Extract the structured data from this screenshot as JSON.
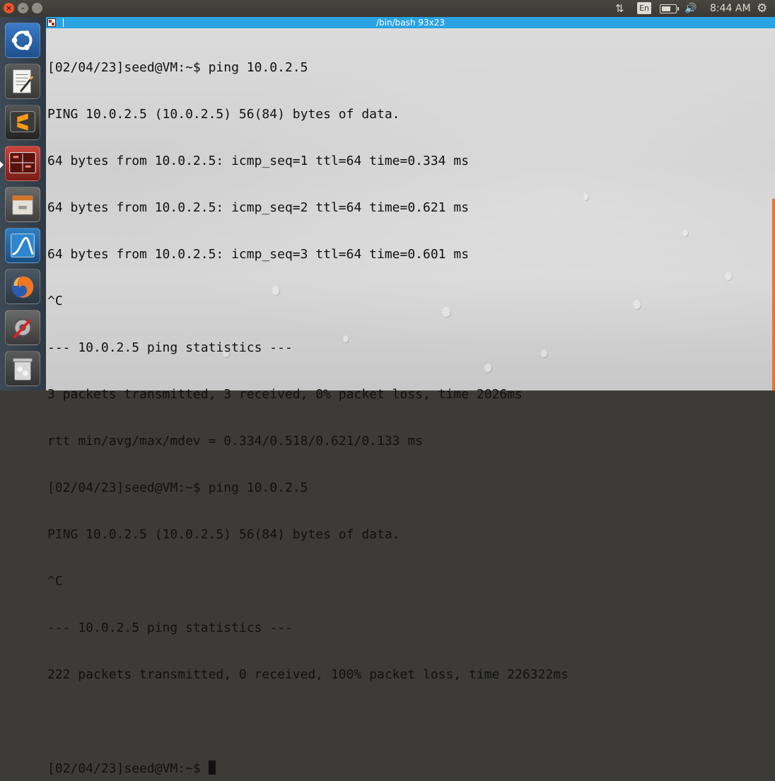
{
  "top_panel": {
    "language": "En",
    "clock": "8:44 AM",
    "volume_glyph": "🔊",
    "network_glyph": "⇅",
    "settings_glyph": "⚙"
  },
  "window_controls": {
    "close": "×",
    "minimize": "–",
    "maximize": ""
  },
  "launcher": {
    "items": [
      {
        "name": "ubuntu-dash",
        "icon": "ubuntu-logo-icon"
      },
      {
        "name": "text-editor",
        "icon": "text-editor-icon"
      },
      {
        "name": "sublime-text",
        "icon": "sublime-text-icon"
      },
      {
        "name": "terminal",
        "icon": "terminal-icon",
        "active": true
      },
      {
        "name": "file-manager",
        "icon": "files-icon"
      },
      {
        "name": "wireshark",
        "icon": "wireshark-icon"
      },
      {
        "name": "firefox",
        "icon": "firefox-icon"
      },
      {
        "name": "system-settings",
        "icon": "settings-icon"
      },
      {
        "name": "trash",
        "icon": "trash-icon"
      }
    ]
  },
  "terminal": {
    "title": "/bin/bash 93x23",
    "lines": [
      "[02/04/23]seed@VM:~$ ping 10.0.2.5",
      "PING 10.0.2.5 (10.0.2.5) 56(84) bytes of data.",
      "64 bytes from 10.0.2.5: icmp_seq=1 ttl=64 time=0.334 ms",
      "64 bytes from 10.0.2.5: icmp_seq=2 ttl=64 time=0.621 ms",
      "64 bytes from 10.0.2.5: icmp_seq=3 ttl=64 time=0.601 ms",
      "^C",
      "--- 10.0.2.5 ping statistics ---",
      "3 packets transmitted, 3 received, 0% packet loss, time 2026ms",
      "rtt min/avg/max/mdev = 0.334/0.518/0.621/0.133 ms",
      "[02/04/23]seed@VM:~$ ping 10.0.2.5",
      "PING 10.0.2.5 (10.0.2.5) 56(84) bytes of data.",
      "^C",
      "--- 10.0.2.5 ping statistics ---",
      "222 packets transmitted, 0 received, 100% packet loss, time 226322ms",
      ""
    ],
    "prompt": "[02/04/23]seed@VM:~$ "
  },
  "colors": {
    "titlebar": "#2aa3e2",
    "panel": "#3c3b37",
    "text": "#111111"
  }
}
